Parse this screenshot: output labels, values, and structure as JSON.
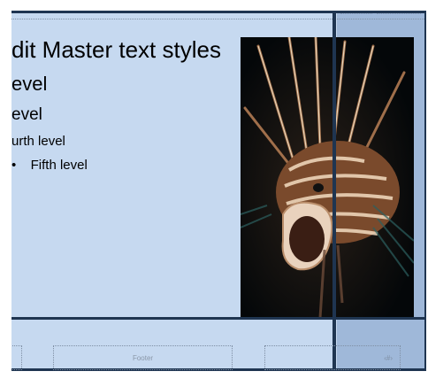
{
  "slide": {
    "title": "dit Master text styles",
    "levels": [
      "evel",
      "evel",
      "urth level",
      "Fifth level"
    ],
    "bullet": "•"
  },
  "footer": {
    "label": "Footer",
    "page_number": "‹#›"
  },
  "image": {
    "subject": "lionfish-photo"
  }
}
